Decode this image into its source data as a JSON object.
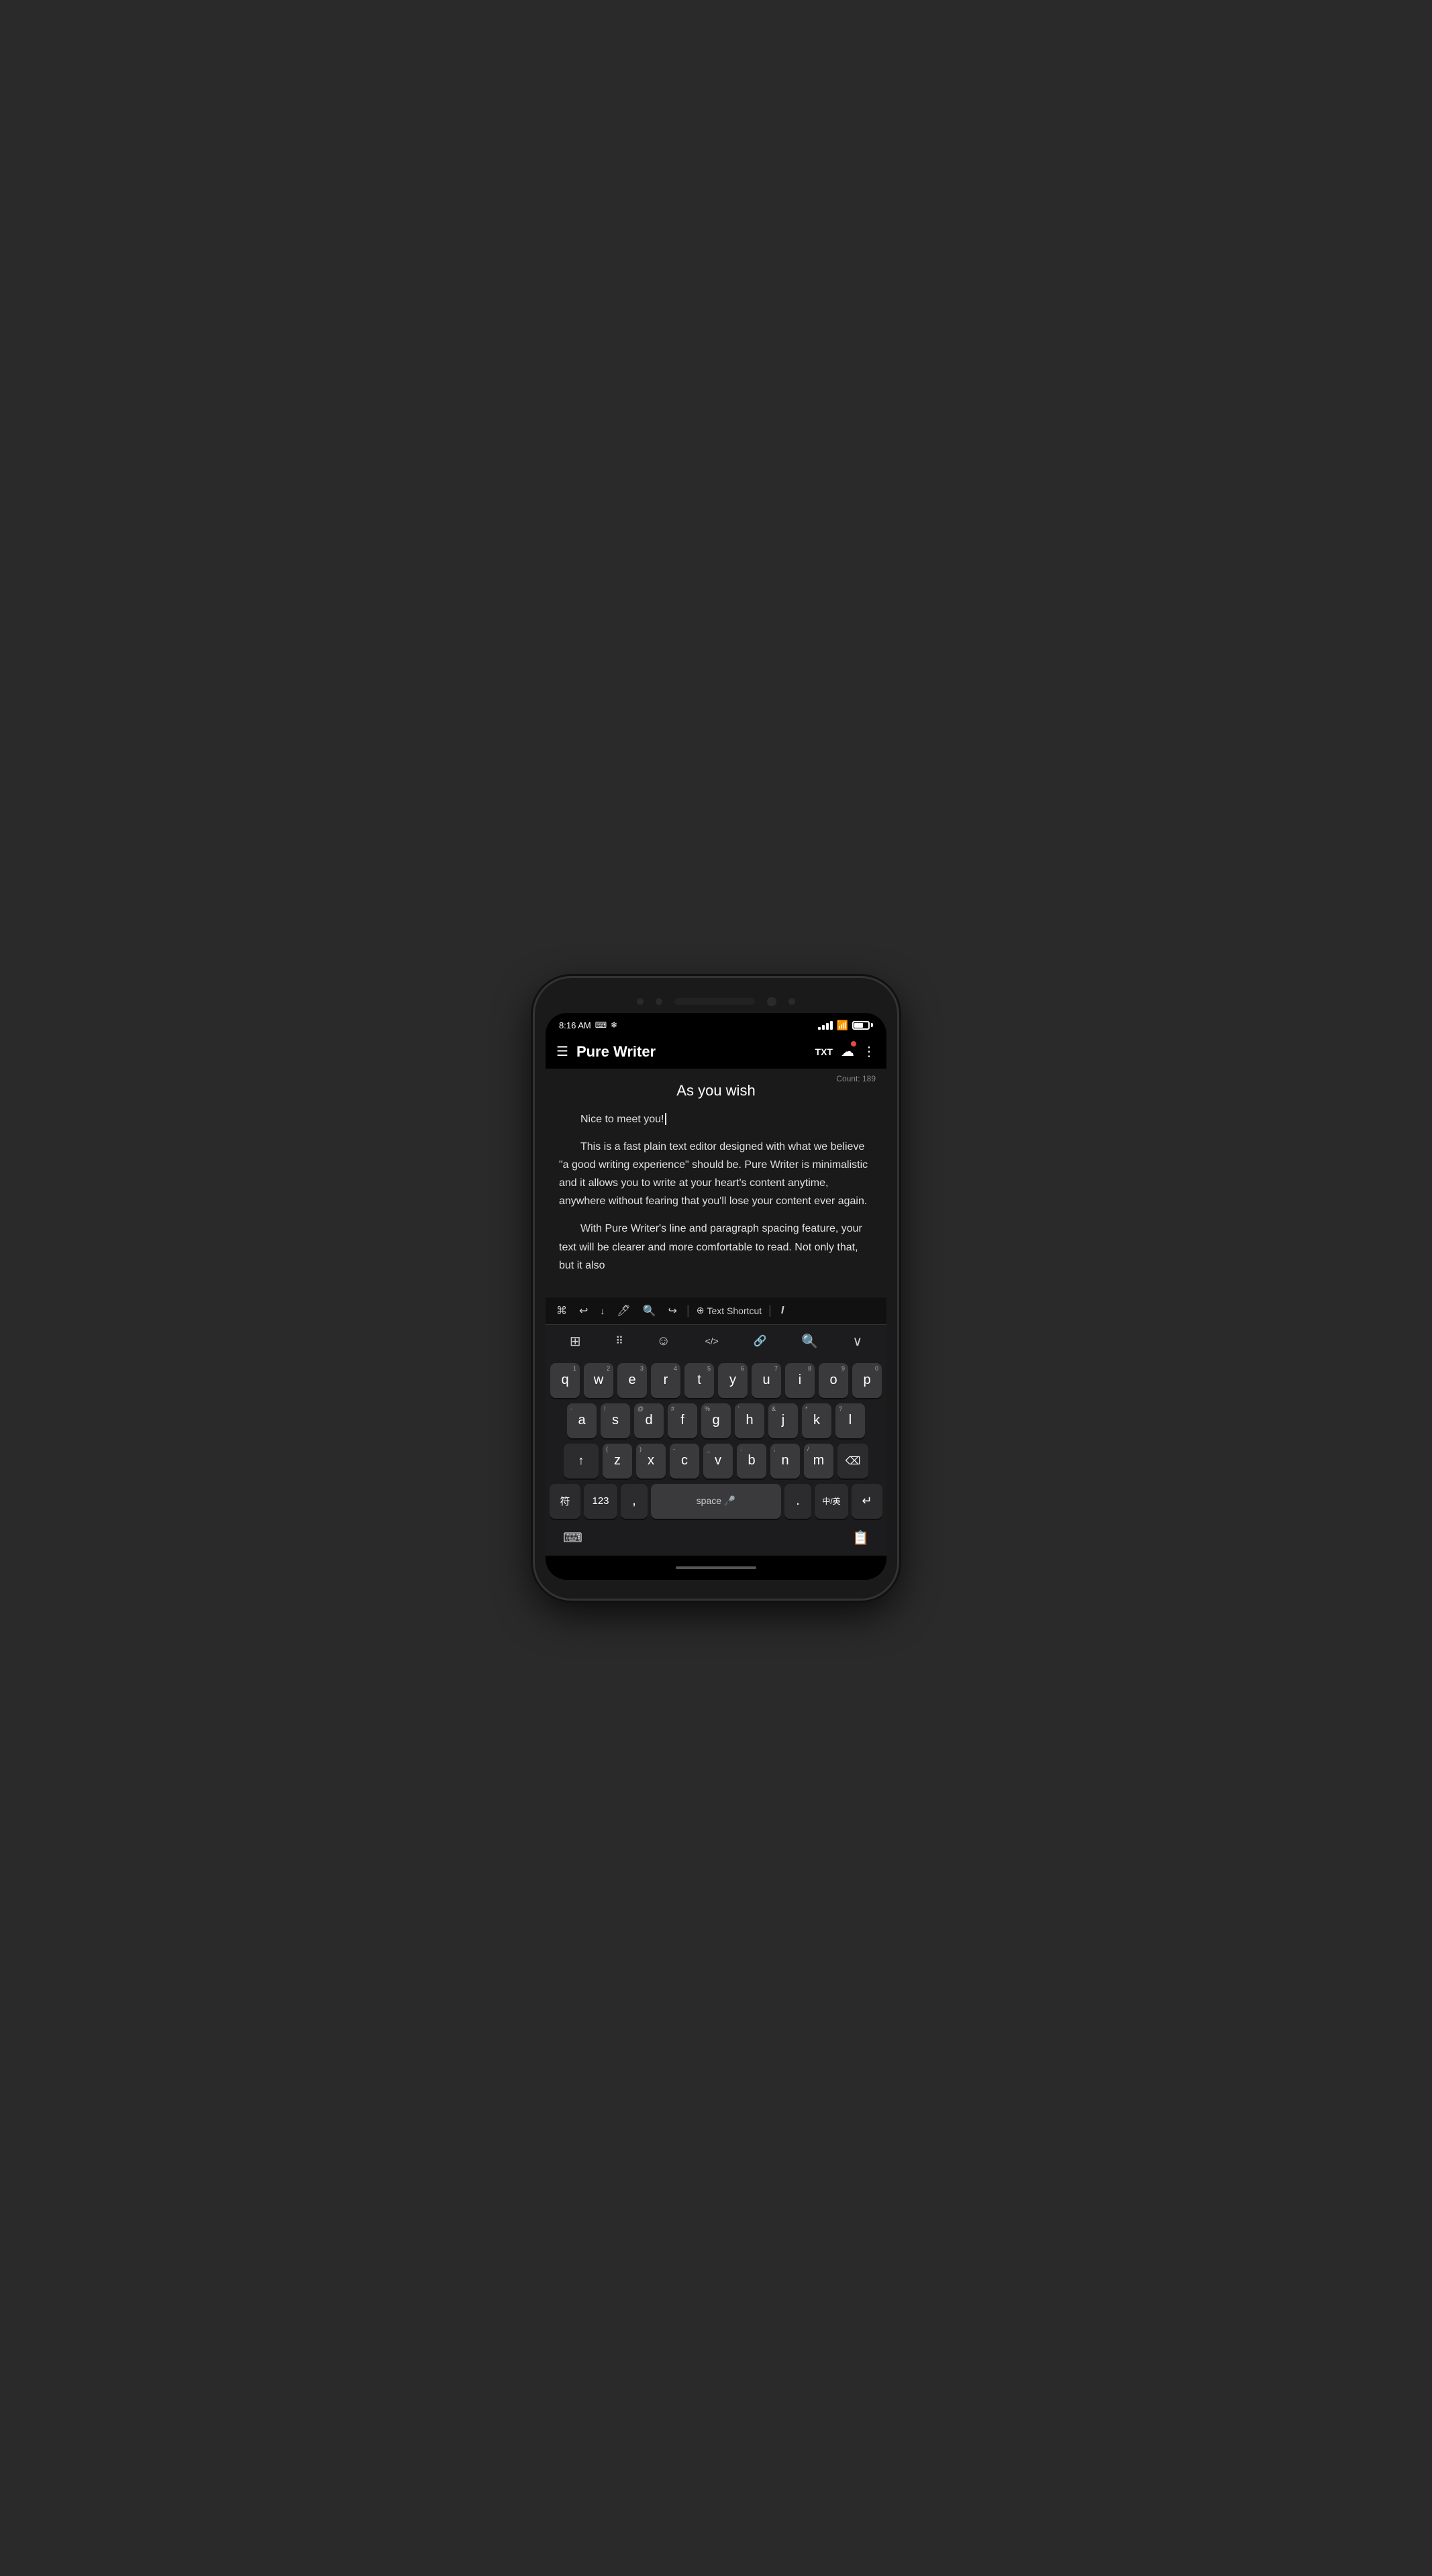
{
  "phone": {
    "status_bar": {
      "time": "8:16 AM",
      "signal_icon": "signal-icon",
      "wifi_icon": "wifi-icon",
      "battery_icon": "battery-icon"
    },
    "app_bar": {
      "menu_icon": "☰",
      "title": "Pure Writer",
      "txt_button": "TXT",
      "cloud_icon": "☁",
      "more_icon": "⋮"
    },
    "content": {
      "word_count": "Count: 189",
      "doc_title": "As you wish",
      "paragraphs": [
        "Nice to meet you!",
        "This is a fast plain text editor designed with what we believe \"a good writing experience\" should be. Pure Writer is minimalistic and it allows you to write at your heart's content anytime, anywhere without fearing that you'll lose your content ever again.",
        "With Pure Writer's line and paragraph spacing feature, your text will be clearer and more comfortable to read. Not only that, but it also"
      ]
    },
    "editor_toolbar": {
      "cmd_icon": "⌘",
      "undo_icon": "↩",
      "download_icon": "↓",
      "format_icon": "🖊",
      "search_icon": "🔍",
      "redo_icon": "↪",
      "add_icon": "⊕",
      "text_shortcut": "Text Shortcut",
      "cursor_icon": "I"
    },
    "keyboard_toolbar": {
      "grid_icon": "⊞",
      "dots_icon": "⠿",
      "emoji_icon": "☺",
      "code_icon": "</>",
      "link_icon": "🔗",
      "search_icon": "🔍",
      "collapse_icon": "∨"
    },
    "keyboard": {
      "rows": [
        [
          {
            "label": "q",
            "num": "1"
          },
          {
            "label": "w",
            "num": "2"
          },
          {
            "label": "e",
            "num": "3"
          },
          {
            "label": "r",
            "num": "4"
          },
          {
            "label": "t",
            "num": "5"
          },
          {
            "label": "y",
            "num": "6"
          },
          {
            "label": "u",
            "num": "7"
          },
          {
            "label": "i",
            "num": "8"
          },
          {
            "label": "o",
            "num": "9"
          },
          {
            "label": "p",
            "num": "0"
          }
        ],
        [
          {
            "label": "a",
            "sym": "-"
          },
          {
            "label": "s",
            "sym": "!"
          },
          {
            "label": "d",
            "sym": "@"
          },
          {
            "label": "f",
            "sym": "#"
          },
          {
            "label": "g",
            "sym": "%"
          },
          {
            "label": "h",
            "sym": "'"
          },
          {
            "label": "j",
            "sym": "&"
          },
          {
            "label": "k",
            "sym": "*"
          },
          {
            "label": "l",
            "sym": "?"
          }
        ],
        [
          {
            "label": "shift",
            "special": true
          },
          {
            "label": "z",
            "sym": "("
          },
          {
            "label": "x",
            "sym": ")"
          },
          {
            "label": "c",
            "sym": "-"
          },
          {
            "label": "v",
            "sym": "_"
          },
          {
            "label": "b",
            "sym": ":"
          },
          {
            "label": "n",
            "sym": ";"
          },
          {
            "label": "m",
            "sym": "/"
          },
          {
            "label": "backspace",
            "special": true
          }
        ],
        [
          {
            "label": "符"
          },
          {
            "label": "123"
          },
          {
            "label": ","
          },
          {
            "label": "space 🎤",
            "space": true
          },
          {
            "label": "."
          },
          {
            "label": "中/英"
          },
          {
            "label": "enter",
            "special": true
          }
        ]
      ],
      "bottom_bar": {
        "keyboard_icon": "⌨",
        "clipboard_icon": "📋"
      }
    }
  }
}
